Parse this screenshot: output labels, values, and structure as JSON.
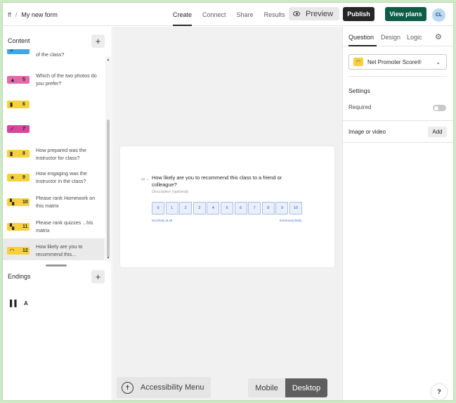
{
  "header": {
    "workspace": "ff",
    "separator": "/",
    "form_name": "My new form",
    "tabs": [
      {
        "label": "Create",
        "active": true
      },
      {
        "label": "Connect",
        "active": false
      },
      {
        "label": "Share",
        "active": false
      },
      {
        "label": "Results",
        "active": false
      }
    ],
    "preview_label": "Preview",
    "publish_label": "Publish",
    "plans_label": "View plans",
    "avatar_initials": "CL"
  },
  "sidebar": {
    "content_title": "Content",
    "add_symbol": "+",
    "items": [
      {
        "num": "",
        "text": "of the class?",
        "color": "#3aa7f0",
        "icon": "grid-icon",
        "glyph": "≡",
        "active": false
      },
      {
        "num": "5",
        "text": "Which of the two photos do you prefer?",
        "color": "#e36aa9",
        "icon": "picture-choice-icon",
        "glyph": "▲",
        "active": false
      },
      {
        "num": "6",
        "text": "",
        "color": "#f7d13d",
        "icon": "rating-bars-icon",
        "glyph": "▮",
        "active": false
      },
      {
        "num": "7",
        "text": "",
        "color": "#d4479c",
        "icon": "checkmark-icon",
        "glyph": "✓",
        "active": false
      },
      {
        "num": "8",
        "text": "How prepared was the instructor for class?",
        "color": "#f7d13d",
        "icon": "rating-bars-icon",
        "glyph": "▮",
        "active": false
      },
      {
        "num": "9",
        "text": "How engaging was the instructor in the class?",
        "color": "#f7d13d",
        "icon": "star-icon",
        "glyph": "★",
        "active": false
      },
      {
        "num": "10",
        "text": "Please rank Homework on this matrix",
        "color": "#f7d13d",
        "icon": "matrix-icon",
        "glyph": "▚",
        "active": false
      },
      {
        "num": "11",
        "text": "Please rank quizzes ...his matrix",
        "color": "#f7d13d",
        "icon": "matrix-icon",
        "glyph": "▚",
        "active": false
      },
      {
        "num": "12",
        "text": "How likely are you to recommend this...",
        "color": "#f7d13d",
        "icon": "gauge-icon",
        "glyph": "◠",
        "active": true
      }
    ],
    "endings_title": "Endings",
    "ending_letter": "A"
  },
  "canvas": {
    "question_number": "12 →",
    "question_title": "How likely are you to recommend this class to a friend or colleague?",
    "description_placeholder": "Description (optional)",
    "scale": [
      "0",
      "1",
      "2",
      "3",
      "4",
      "5",
      "6",
      "7",
      "8",
      "9",
      "10"
    ],
    "low_label": "Not likely at all",
    "high_label": "Extremely likely",
    "accessibility_label": "Accessibility Menu",
    "view_mobile": "Mobile",
    "view_desktop": "Desktop",
    "selected_view": "Desktop"
  },
  "panel": {
    "tabs": [
      {
        "label": "Question",
        "active": true
      },
      {
        "label": "Design",
        "active": false
      },
      {
        "label": "Logic",
        "active": false
      }
    ],
    "question_type": "Net Promoter Score®",
    "settings_title": "Settings",
    "required_label": "Required",
    "required_on": false,
    "image_label": "Image or video",
    "add_label": "Add",
    "help_label": "?"
  }
}
